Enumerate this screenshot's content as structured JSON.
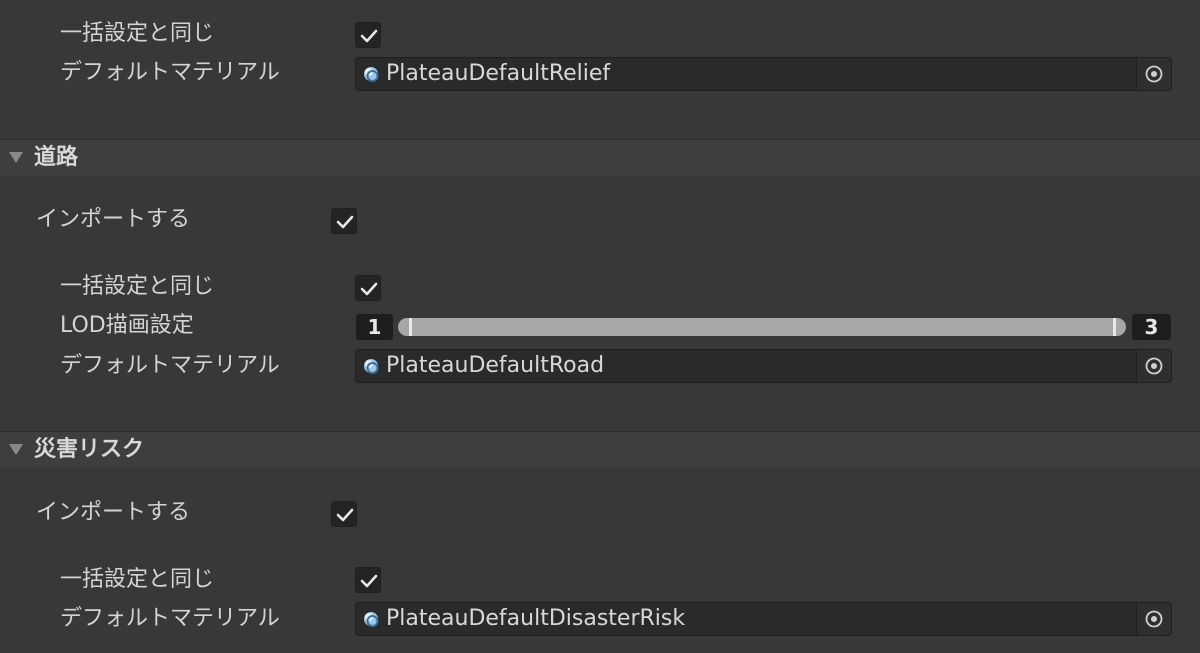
{
  "sections": {
    "relief_tail": {
      "same_as_bulk_label": "一括設定と同じ",
      "same_as_bulk_checked": true,
      "default_material_label": "デフォルトマテリアル",
      "default_material_value": "PlateauDefaultRelief"
    },
    "road": {
      "title": "道路",
      "import_label": "インポートする",
      "import_checked": true,
      "same_as_bulk_label": "一括設定と同じ",
      "same_as_bulk_checked": true,
      "lod_label": "LOD描画設定",
      "lod_min": "1",
      "lod_max": "3",
      "default_material_label": "デフォルトマテリアル",
      "default_material_value": "PlateauDefaultRoad"
    },
    "disaster": {
      "title": "災害リスク",
      "import_label": "インポートする",
      "import_checked": true,
      "same_as_bulk_label": "一括設定と同じ",
      "same_as_bulk_checked": true,
      "default_material_label": "デフォルトマテリアル",
      "default_material_value": "PlateauDefaultDisasterRisk"
    }
  },
  "icons": {
    "checkmark": "check-icon",
    "foldout": "triangle-down-icon",
    "material": "material-sphere-icon",
    "object_picker": "target-icon"
  },
  "colors": {
    "background": "#383838",
    "field_background": "#2a2a2a",
    "slider_track": "#a7a7a7"
  }
}
